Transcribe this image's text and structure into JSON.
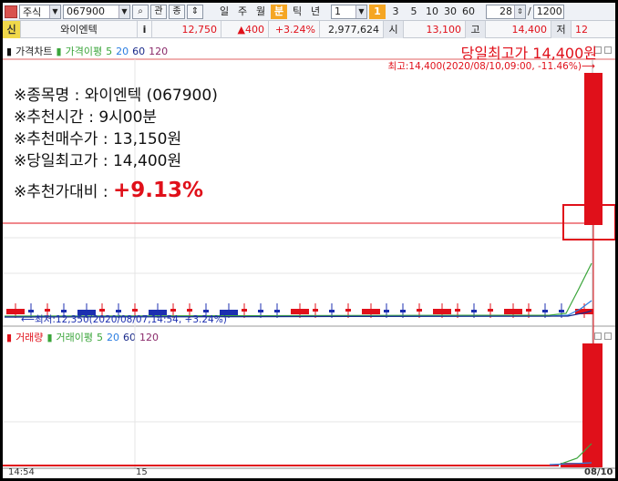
{
  "toolbar": {
    "market_select": "주식",
    "code_input": "067900",
    "btn_search": "⌕",
    "btn_watch": "관",
    "btn_rank": "종",
    "periods": [
      "일",
      "주",
      "월",
      "분",
      "틱",
      "년"
    ],
    "active_period": "분",
    "interval_input": "1",
    "interval_buttons": [
      "1",
      "3",
      "5",
      "10",
      "30",
      "60"
    ],
    "active_interval": "1",
    "count_input": "28",
    "slash": "/",
    "max_count": "1200"
  },
  "quote": {
    "badge": "신",
    "name": "와이엔텍",
    "info_btn": "i",
    "price": "12,750",
    "change": "▲400",
    "change_pct": "+3.24%",
    "volume": "2,977,624",
    "open_label": "시",
    "open_value": "13,100",
    "high_label": "고",
    "high_value": "14,400",
    "low_label": "저",
    "low_value": "12"
  },
  "price_panel": {
    "legend_price": "가격차트",
    "legend_ma": "가격이평",
    "ma_periods": [
      "5",
      "20",
      "60",
      "120"
    ],
    "high_annotation_title": "당일최고가 14,400원",
    "high_marker": "최고:14,400(2020/08/10,09:00, -11.46%)⟶",
    "low_marker": "⟵최저:12,350(2020/08/07,14:54, +3.24%)"
  },
  "info": {
    "line1": "※종목명 : 와이엔텍 (067900)",
    "line2": "※추천시간 : 9시00분",
    "line3": "※추천매수가 : 13,150원",
    "line4": "※당일최고가 : 14,400원",
    "line5_label": "※추천가대비 : ",
    "line5_value": "+9.13%"
  },
  "volume_panel": {
    "legend_volume": "거래량",
    "legend_ma": "거래이평",
    "ma_periods": [
      "5",
      "20",
      "60",
      "120"
    ]
  },
  "xaxis": {
    "left": "14:54",
    "mid": "15",
    "right": "08/10"
  },
  "colors": {
    "up": "#e0101a",
    "down": "#1c2fb0",
    "ma5": "#3aa53a",
    "ma20": "#2a7de1",
    "ma60": "#1a2a8a",
    "ma120": "#8a2a6a"
  }
}
